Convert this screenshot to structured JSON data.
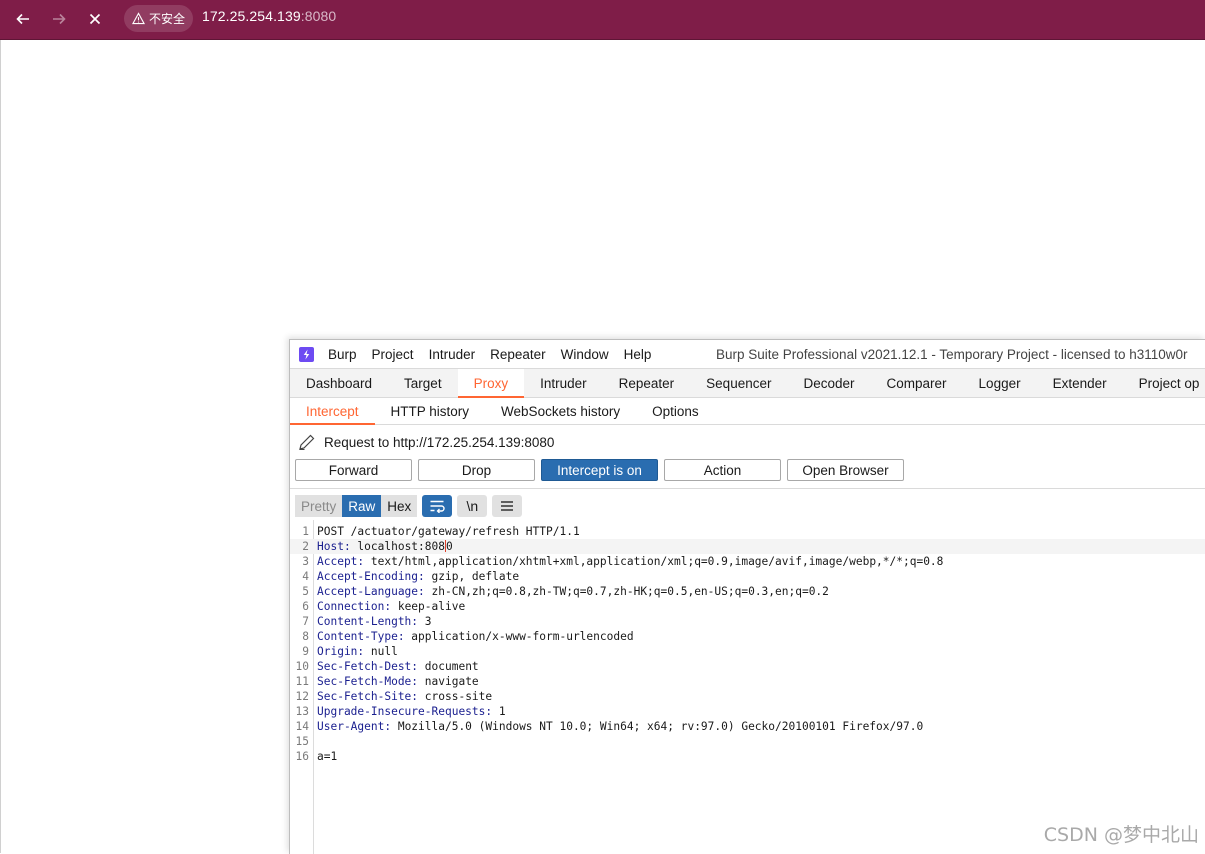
{
  "browser": {
    "security_label": "不安全",
    "url_host": "172.25.254.139",
    "url_port": ":8080"
  },
  "burp": {
    "menu": [
      "Burp",
      "Project",
      "Intruder",
      "Repeater",
      "Window",
      "Help"
    ],
    "title": "Burp Suite Professional v2021.12.1 - Temporary Project - licensed to h3110w0r",
    "main_tabs": [
      "Dashboard",
      "Target",
      "Proxy",
      "Intruder",
      "Repeater",
      "Sequencer",
      "Decoder",
      "Comparer",
      "Logger",
      "Extender",
      "Project op"
    ],
    "main_tab_active": "Proxy",
    "sub_tabs": [
      "Intercept",
      "HTTP history",
      "WebSockets history",
      "Options"
    ],
    "sub_tab_active": "Intercept",
    "request_to": "Request to http://172.25.254.139:8080",
    "buttons": {
      "forward": "Forward",
      "drop": "Drop",
      "intercept": "Intercept is on",
      "action": "Action",
      "open_browser": "Open Browser"
    },
    "view": {
      "pretty": "Pretty",
      "raw": "Raw",
      "hex": "Hex",
      "newline": "\\n"
    },
    "request_lines": [
      {
        "n": "1",
        "name": "",
        "value": "POST /actuator/gateway/refresh HTTP/1.1"
      },
      {
        "n": "2",
        "name": "Host:",
        "value": " localhost:808",
        "tail": "0"
      },
      {
        "n": "3",
        "name": "Accept:",
        "value": " text/html,application/xhtml+xml,application/xml;q=0.9,image/avif,image/webp,*/*;q=0.8"
      },
      {
        "n": "4",
        "name": "Accept-Encoding:",
        "value": " gzip, deflate"
      },
      {
        "n": "5",
        "name": "Accept-Language:",
        "value": " zh-CN,zh;q=0.8,zh-TW;q=0.7,zh-HK;q=0.5,en-US;q=0.3,en;q=0.2"
      },
      {
        "n": "6",
        "name": "Connection:",
        "value": " keep-alive"
      },
      {
        "n": "7",
        "name": "Content-Length:",
        "value": " 3"
      },
      {
        "n": "8",
        "name": "Content-Type:",
        "value": " application/x-www-form-urlencoded"
      },
      {
        "n": "9",
        "name": "Origin:",
        "value": " null"
      },
      {
        "n": "10",
        "name": "Sec-Fetch-Dest:",
        "value": " document"
      },
      {
        "n": "11",
        "name": "Sec-Fetch-Mode:",
        "value": " navigate"
      },
      {
        "n": "12",
        "name": "Sec-Fetch-Site:",
        "value": " cross-site"
      },
      {
        "n": "13",
        "name": "Upgrade-Insecure-Requests:",
        "value": " 1"
      },
      {
        "n": "14",
        "name": "User-Agent:",
        "value": " Mozilla/5.0 (Windows NT 10.0; Win64; x64; rv:97.0) Gecko/20100101 Firefox/97.0"
      },
      {
        "n": "15",
        "name": "",
        "value": ""
      },
      {
        "n": "16",
        "name": "",
        "value": "a=1"
      }
    ]
  },
  "watermark": "CSDN @梦中北山",
  "colors": {
    "browser_bar": "#7f1d48",
    "burp_accent": "#ff6633",
    "button_on": "#2a6db0",
    "header_name": "#1a1f8f"
  }
}
